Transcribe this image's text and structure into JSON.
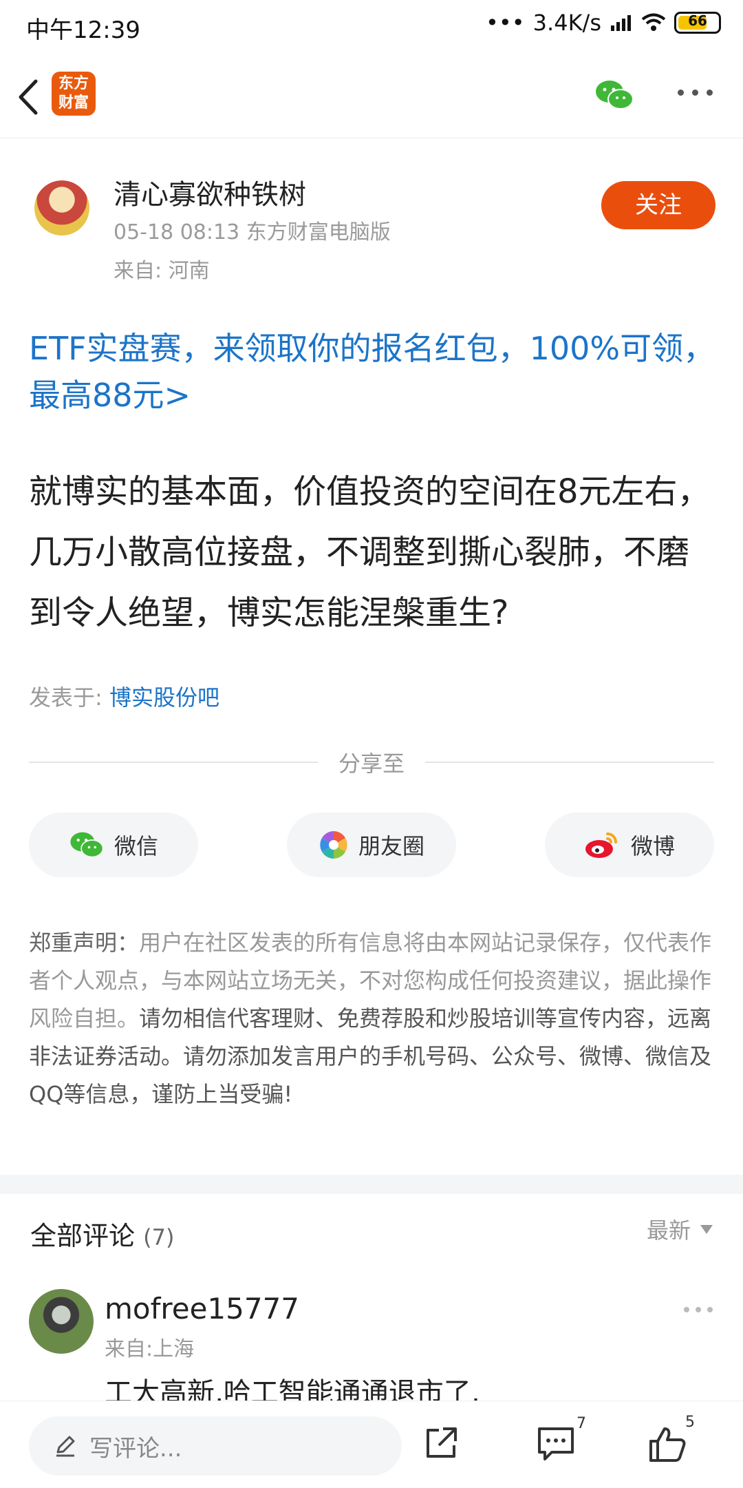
{
  "status_bar": {
    "time": "中午12:39",
    "network_speed": "3.4K/s",
    "battery": "66"
  },
  "nav": {
    "logo_text_line1": "东方",
    "logo_text_line2": "财富"
  },
  "author": {
    "name": "清心寡欲种铁树",
    "meta": "05-18 08:13 东方财富电脑版",
    "from": "来自: 河南",
    "follow_label": "关注"
  },
  "promo": "ETF实盘赛，来领取你的报名红包，100%可领，最高88元>",
  "post_body": "就博实的基本面，价值投资的空间在8元左右，几万小散高位接盘，不调整到撕心裂肺，不磨到令人绝望，博实怎能涅槃重生?",
  "posted_in": {
    "prefix": "发表于:",
    "bar": "博实股份吧"
  },
  "share": {
    "label": "分享至",
    "wechat": "微信",
    "moments": "朋友圈",
    "weibo": "微博"
  },
  "disclaimer": {
    "head": "郑重声明：",
    "part1": "用户在社区发表的所有信息将由本网站记录保存，仅代表作者个人观点，与本网站立场无关，不对您构成任何投资建议，据此操作风险自担。",
    "part2": "请勿相信代客理财、免费荐股和炒股培训等宣传内容，远离非法证券活动。请勿添加发言用户的手机号码、公众号、微博、微信及QQ等信息，谨防上当受骗!"
  },
  "comments": {
    "title": "全部评论",
    "count": "(7)",
    "sort": "最新",
    "first": {
      "name": "mofree15777",
      "from": "来自:上海",
      "text": "工大高新,哈工智能通通退市了,"
    }
  },
  "bottom_bar": {
    "placeholder": "写评论...",
    "comment_count": "7",
    "like_count": "5"
  },
  "colors": {
    "accent": "#ea4e0d",
    "link": "#1c74c8",
    "wechat_green": "#3fb837",
    "weibo_red": "#e6162d"
  }
}
